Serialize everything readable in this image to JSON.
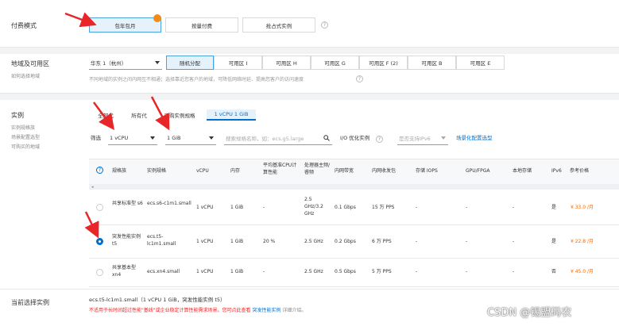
{
  "billing": {
    "label": "付费模式",
    "options": [
      "包年包月",
      "按量付费",
      "抢占式实例"
    ]
  },
  "region": {
    "label": "地域及可用区",
    "help_link": "如何选择地域",
    "region_value": "华东 1（杭州）",
    "zones": [
      "随机分配",
      "可用区 I",
      "可用区 H",
      "可用区 G",
      "可用区 F (2)",
      "可用区 B",
      "可用区 E"
    ],
    "note": "不同地域的实例之间内网互不相通；选择靠近您客户的地域，可降低网络时延、提高您客户的访问速度"
  },
  "instance": {
    "label": "实例",
    "side_links": [
      "实例规格族",
      "场景配置选型",
      "可购买的地域"
    ],
    "tabs": [
      "全部代",
      "所有代",
      "已购实例规格",
      "1 vCPU 1 GiB"
    ],
    "filter_label": "筛选",
    "vcpu_value": "1 vCPU",
    "mem_value": "1 GiB",
    "search_placeholder": "搜索规格名称，如：ecs.g5.large",
    "io_label": "I/O 优化实例",
    "ipv6_placeholder": "是否支持IPv6",
    "scene_link": "场景化配置选型",
    "headers": [
      "规格族",
      "实例规格",
      "vCPU",
      "内存",
      "平均基准CPU计算性能",
      "处理器主频/睿频",
      "内网带宽",
      "内网收发包",
      "存储 IOPS",
      "GPU/FPGA",
      "本地存储",
      "IPv6",
      "参考价格"
    ],
    "rows": [
      {
        "family": "共享标准型 s6",
        "spec": "ecs.s6-c1m1.small",
        "vcpu": "1 vCPU",
        "mem": "1 GiB",
        "baseline": "-",
        "freq": "2.5 GHz/3.2 GHz",
        "bw": "0.1 Gbps",
        "pps": "15 万 PPS",
        "iops": "-",
        "gpu": "-",
        "local": "-",
        "ipv6": "是",
        "price": "¥ 33.0 /月",
        "selected": false
      },
      {
        "family": "突发性能实例 t5",
        "spec": "ecs.t5-lc1m1.small",
        "vcpu": "1 vCPU",
        "mem": "1 GiB",
        "baseline": "20 %",
        "freq": "2.5 GHz",
        "bw": "0.2 Gbps",
        "pps": "6 万 PPS",
        "iops": "-",
        "gpu": "-",
        "local": "-",
        "ipv6": "是",
        "price": "¥ 22.8 /月",
        "selected": true
      },
      {
        "family": "共享基本型 xn4",
        "spec": "ecs.xn4.small",
        "vcpu": "1 vCPU",
        "mem": "1 GiB",
        "baseline": "-",
        "freq": "2.5 GHz",
        "bw": "0.5 Gbps",
        "pps": "5 万 PPS",
        "iops": "-",
        "gpu": "-",
        "local": "-",
        "ipv6": "否",
        "price": "¥ 45.0 /月",
        "selected": false
      }
    ]
  },
  "current": {
    "label": "当前选择实例",
    "value": "ecs.t5-lc1m1.small（1 vCPU 1 GiB，突发性能实例 t5）",
    "warning": "不适用于长时间超过性能\"基线\"或企业稳定计算性能需求场景。您可点此查看",
    "warning_link": "突发性能实例",
    "warning_tail": "详细介绍。"
  },
  "watermark": "CSDN @锡盟码农",
  "colors": {
    "accent": "#0070cc",
    "price": "#ff6a00",
    "arrow": "#e8262a",
    "selected_bg": "#e6f2fb"
  }
}
